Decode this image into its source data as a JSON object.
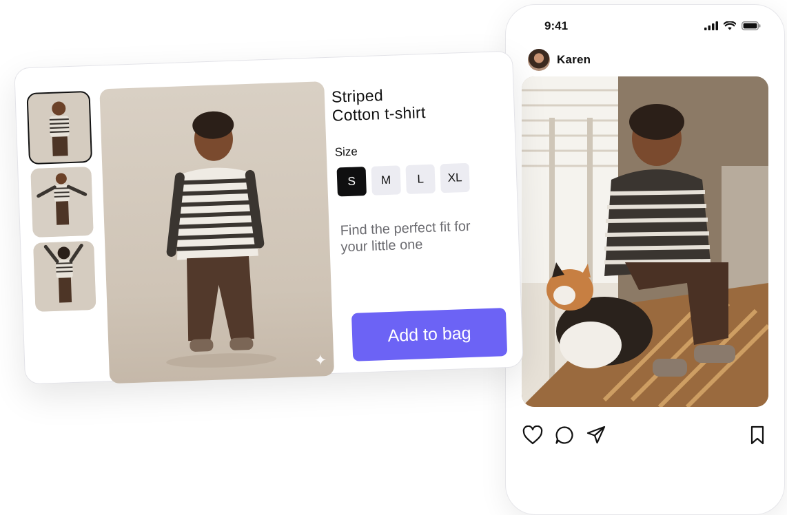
{
  "phone": {
    "status_time": "9:41",
    "username": "Karen"
  },
  "product": {
    "title_line1": "Striped",
    "title_line2": "Cotton t-shirt",
    "size_label": "Size",
    "sizes": [
      "S",
      "M",
      "L",
      "XL"
    ],
    "selected_size": "S",
    "helper_text": "Find the perfect fit for your little one",
    "add_to_bag_label": "Add to bag"
  },
  "colors": {
    "accent": "#6c63f5",
    "selected_size_bg": "#0f0f10",
    "size_bg": "#ececf2"
  }
}
